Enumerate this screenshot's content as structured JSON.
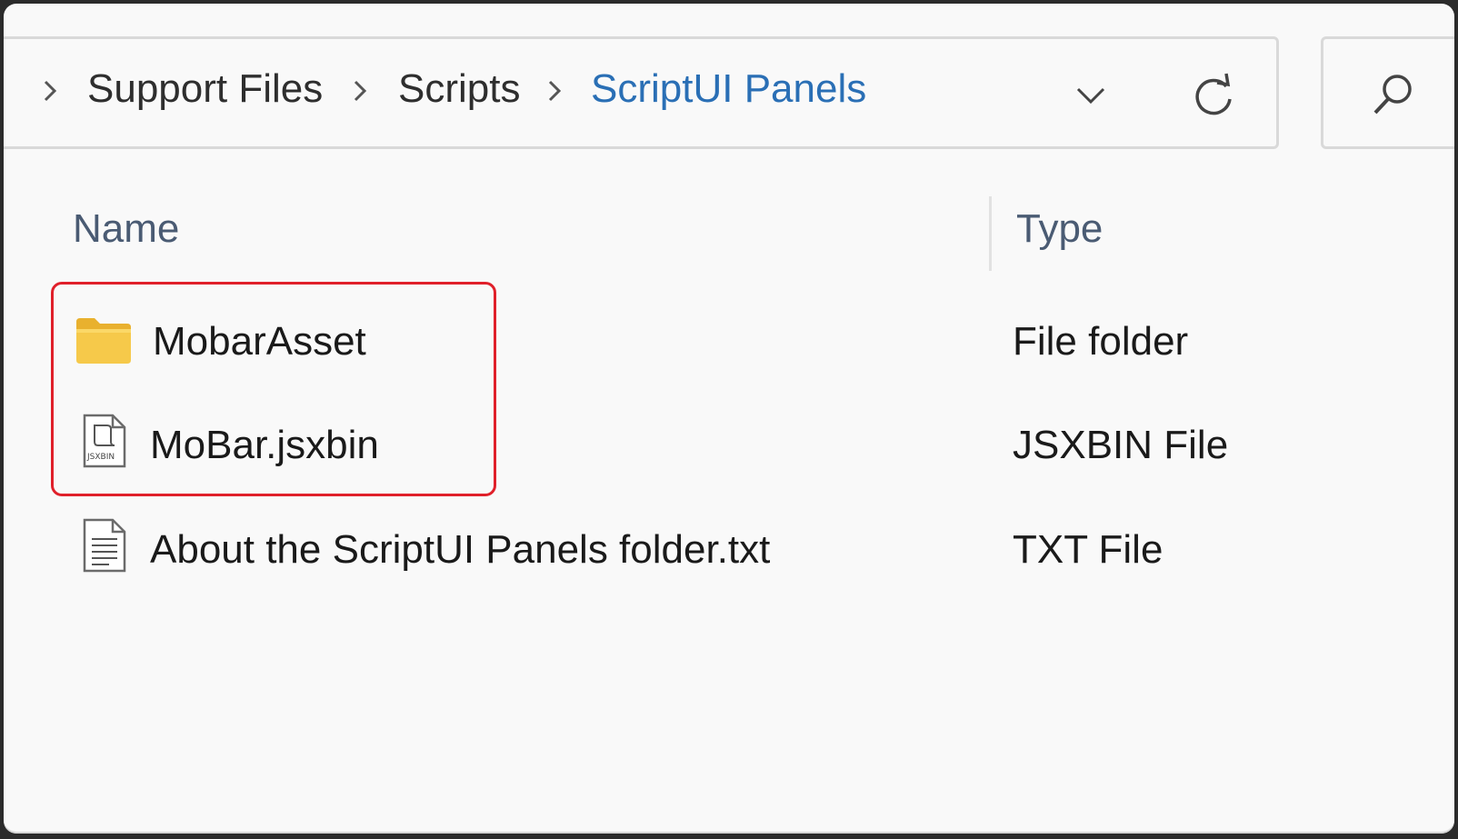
{
  "breadcrumb": {
    "items": [
      {
        "label": "Support Files"
      },
      {
        "label": "Scripts"
      },
      {
        "label": "ScriptUI Panels"
      }
    ]
  },
  "columns": {
    "name_label": "Name",
    "type_label": "Type"
  },
  "files": [
    {
      "name": "MobarAsset",
      "type": "File folder",
      "icon": "folder-icon"
    },
    {
      "name": "MoBar.jsxbin",
      "type": "JSXBIN File",
      "icon": "jsxbin-file-icon",
      "icon_text": "JSXBIN"
    },
    {
      "name": "About the ScriptUI Panels folder.txt",
      "type": "TXT File",
      "icon": "text-file-icon"
    }
  ],
  "icons": {
    "address_dropdown": "chevron-down-icon",
    "refresh": "refresh-icon",
    "search": "search-icon"
  },
  "colors": {
    "current_crumb": "#2a6fb5",
    "highlight_border": "#e0202a",
    "folder": "#f6c94a"
  }
}
